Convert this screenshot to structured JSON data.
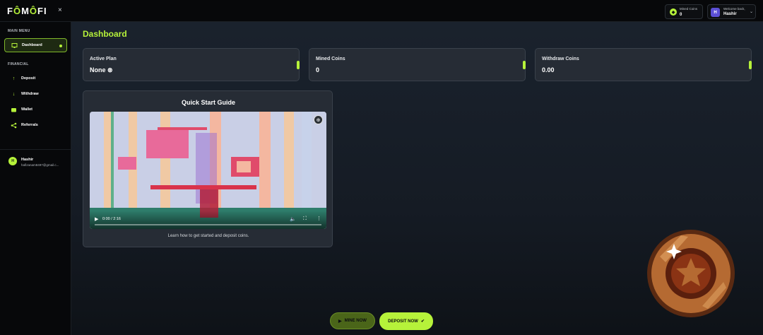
{
  "app": {
    "logo_left": "F",
    "logo_o1": "Ô",
    "logo_mid": "M",
    "logo_o2": "Ô",
    "logo_right": "FI",
    "close_icon": "×"
  },
  "header": {
    "mined_label": "Mined Coins",
    "mined_value": "0",
    "welcome_label": "Welcome back,",
    "user_name": "Hashir",
    "user_initial": "H"
  },
  "sidebar": {
    "main_menu_title": "MAIN MENU",
    "financial_title": "FINANCIAL",
    "items": [
      {
        "label": "Dashboard",
        "icon": "monitor-icon",
        "active": true
      },
      {
        "label": "Deposit",
        "icon": "arrow-up-icon"
      },
      {
        "label": "Withdraw",
        "icon": "arrow-down-icon"
      },
      {
        "label": "Wallet",
        "icon": "wallet-icon"
      },
      {
        "label": "Referrals",
        "icon": "share-icon"
      }
    ],
    "profile": {
      "initial": "H",
      "name": "Hashir",
      "email": "hafizanam8497@gmail.c..."
    }
  },
  "main": {
    "title": "Dashboard",
    "cards": [
      {
        "label": "Active Plan",
        "value": "None ⊗"
      },
      {
        "label": "Mined Coins",
        "value": "0"
      },
      {
        "label": "Withdraw Coins",
        "value": "0.00"
      }
    ],
    "guide": {
      "title": "Quick Start Guide",
      "time": "0:00 / 2:16",
      "caption": "Learn how to get started and deposit coins."
    },
    "buttons": {
      "mine": "MINE NOW",
      "deposit": "DEPOSIT NOW"
    }
  },
  "colors": {
    "accent": "#b6f23a",
    "card": "#262c35",
    "bg": "#07080a"
  }
}
